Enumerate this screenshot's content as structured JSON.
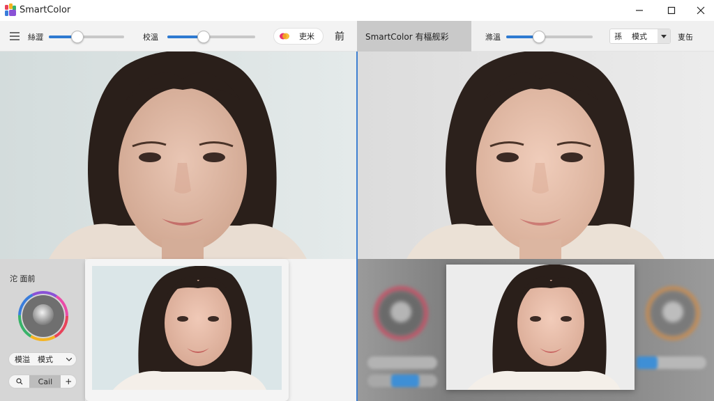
{
  "window": {
    "title": "SmartColor"
  },
  "left_toolbar": {
    "slider1_label": "絲澀",
    "slider1_value": 0.3,
    "slider2_label": "校溫",
    "slider2_value": 0.4,
    "pill_label": "吏米",
    "right_label": "前"
  },
  "right_toolbar": {
    "tab_title": "SmartColor 有楅舰彩",
    "slider_label": "滌溫",
    "slider_value": 0.38,
    "select_prefix": "孫",
    "select_value": "模式",
    "right_label": "叓缶"
  },
  "left_panel": {
    "label": "沱 面前",
    "dropdown_value": "模溢　模式",
    "button_search_icon": "search-icon",
    "button_middle_label": "Cail",
    "button_plus_label": "+"
  },
  "colors": {
    "accent": "#2e7ad1",
    "divider": "#3d7fd1"
  }
}
